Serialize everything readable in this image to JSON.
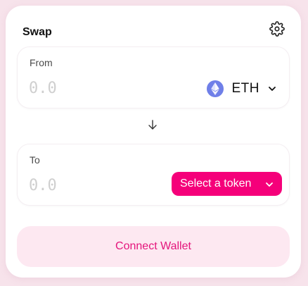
{
  "header": {
    "title": "Swap",
    "settings_icon": "gear-icon"
  },
  "from": {
    "label": "From",
    "amount_placeholder": "0.0",
    "token": {
      "symbol": "ETH",
      "icon": "ethereum-icon",
      "color": "#6f7fe8"
    }
  },
  "switch_icon": "arrow-down-icon",
  "to": {
    "label": "To",
    "amount_placeholder": "0.0",
    "select_label": "Select a token"
  },
  "connect": {
    "label": "Connect Wallet"
  },
  "colors": {
    "accent": "#f5007a",
    "connect_bg": "#fde8f1",
    "connect_text": "#e4157c",
    "page_bg": "#f7e3eb"
  }
}
